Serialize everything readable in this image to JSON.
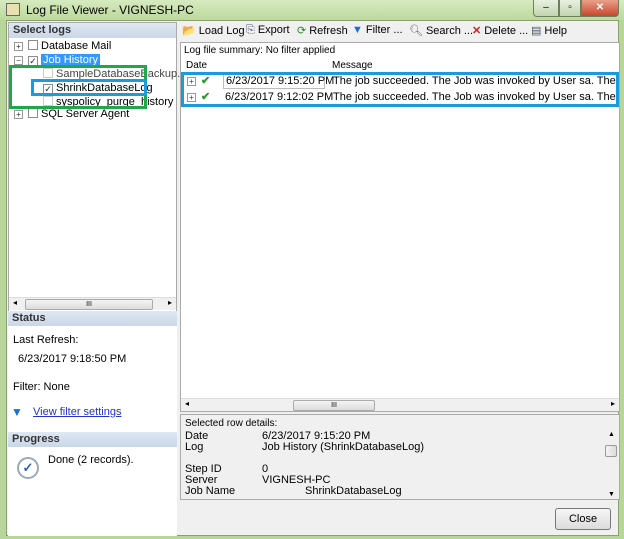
{
  "window": {
    "title": "Log File Viewer - VIGNESH-PC",
    "minimize": "–",
    "maximize": "▫",
    "close": "✕"
  },
  "select_logs": {
    "header": "Select logs",
    "items": [
      {
        "label": "Database Mail",
        "checked": false
      },
      {
        "label": "Job History",
        "checked": true,
        "selected": true
      },
      {
        "label": "SampleDatabaseBackup.Sub",
        "checked": false
      },
      {
        "label": "ShrinkDatabaseLog",
        "checked": true
      },
      {
        "label": "syspolicy_purge_history",
        "checked": false
      },
      {
        "label": "SQL Server Agent",
        "checked": false
      }
    ],
    "scroll_grip": "III"
  },
  "status": {
    "header": "Status",
    "last_refresh_label": "Last Refresh:",
    "last_refresh": "6/23/2017 9:18:50 PM",
    "filter": "Filter: None",
    "view_filter_link": "View filter settings"
  },
  "progress": {
    "header": "Progress",
    "text": "Done (2 records)."
  },
  "toolbar": {
    "load_log": "Load Log",
    "export": "Export",
    "refresh": "Refresh",
    "filter": "Filter ...",
    "search": "Search ...",
    "delete": "Delete ...",
    "help": "Help"
  },
  "grid": {
    "summary": "Log file summary: No filter applied",
    "columns": [
      "Date",
      "Message"
    ],
    "rows": [
      {
        "date": "6/23/2017 9:15:20 PM",
        "message": "The job succeeded.  The Job was invoked by User sa.  The last step to"
      },
      {
        "date": "6/23/2017 9:12:02 PM",
        "message": "The job succeeded.  The Job was invoked by User sa.  The last step to"
      }
    ],
    "scroll_grip": "III"
  },
  "details": {
    "header": "Selected row details:",
    "fields": [
      {
        "label": "Date",
        "value": "6/23/2017 9:15:20 PM"
      },
      {
        "label": "Log",
        "value": "Job History (ShrinkDatabaseLog)"
      },
      {
        "label": "Step ID",
        "value": "0"
      },
      {
        "label": "Server",
        "value": "VIGNESH-PC"
      },
      {
        "label": "Job Name",
        "value": "ShrinkDatabaseLog"
      }
    ]
  },
  "close_button": "Close",
  "colors": {
    "highlight_green": "#1fa84a",
    "highlight_blue": "#1a9be0",
    "selection": "#3399ff"
  }
}
